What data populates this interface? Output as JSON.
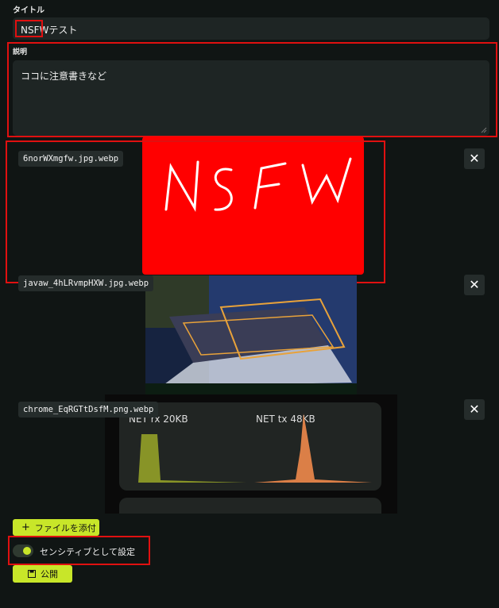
{
  "title_section": {
    "label": "タイトル",
    "value": "NSFWテスト"
  },
  "description_section": {
    "label": "説明",
    "value": "ココに注意書きなど"
  },
  "attachments": [
    {
      "filename": "6norWXmgfw.jpg.webp",
      "preview_text": "NSFW"
    },
    {
      "filename": "javaw_4hLRvmpHXW.jpg.webp"
    },
    {
      "filename": "chrome_EqRGTtDsfM.png.webp",
      "chart_labels": [
        "NET rx 20KB",
        "NET tx 48KB"
      ]
    }
  ],
  "actions": {
    "attach_label": "ファイルを添付",
    "sensitive_label": "センシティブとして設定",
    "sensitive_on": true,
    "publish_label": "公開"
  },
  "colors": {
    "accent": "#c8e629",
    "highlight": "#e01010",
    "background": "#101514"
  }
}
